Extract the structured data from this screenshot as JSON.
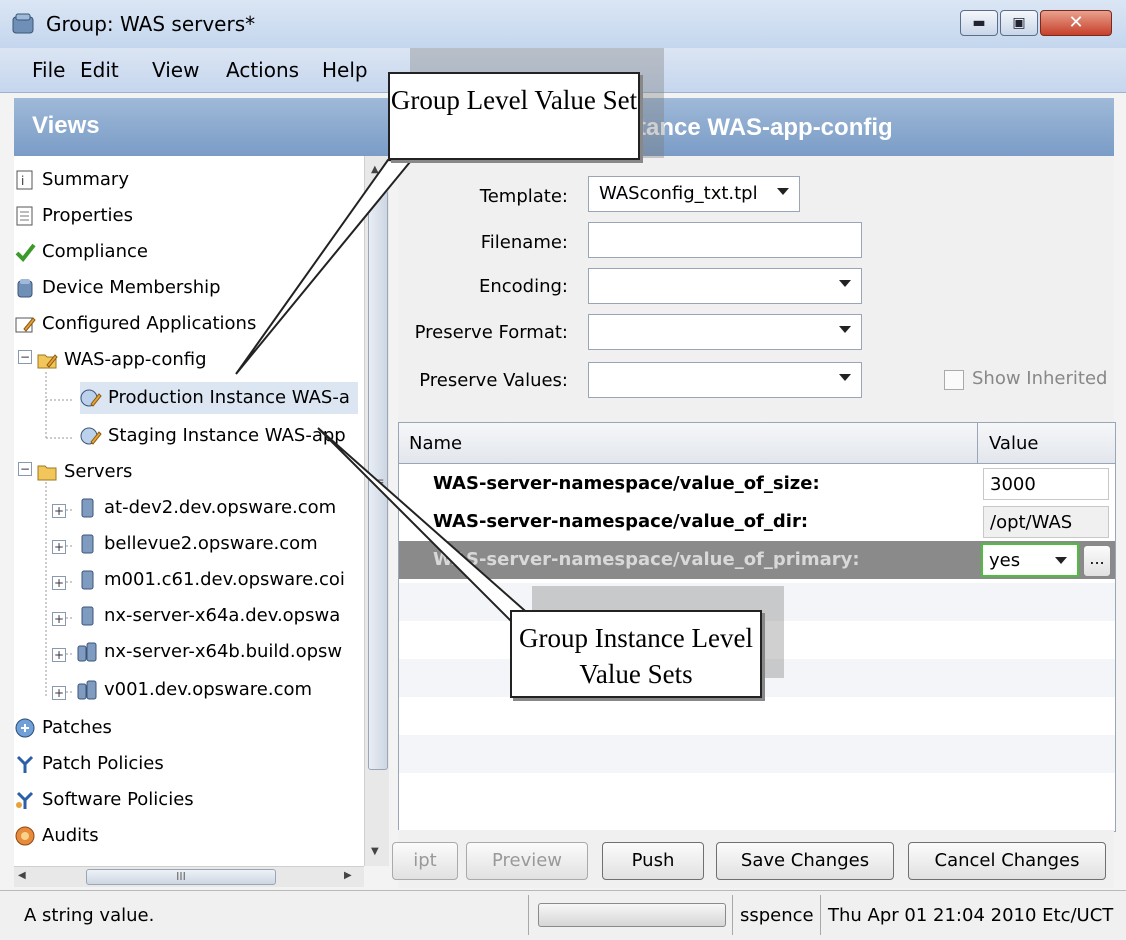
{
  "window": {
    "title": "Group: WAS servers*",
    "min_glyph": "▬",
    "max_glyph": "▣",
    "close_glyph": "✕"
  },
  "menu": [
    "File",
    "Edit",
    "View",
    "Actions",
    "Help"
  ],
  "left": {
    "title": "Views",
    "tree": [
      {
        "label": "Summary",
        "icon": "summary-icon"
      },
      {
        "label": "Properties",
        "icon": "properties-icon"
      },
      {
        "label": "Compliance",
        "icon": "compliance-icon"
      },
      {
        "label": "Device Membership",
        "icon": "device-membership-icon"
      },
      {
        "label": "Configured Applications",
        "icon": "configured-applications-icon"
      },
      {
        "label": "WAS-app-config",
        "icon": "app-config-icon"
      },
      {
        "label": "Production Instance WAS-a",
        "icon": "instance-icon"
      },
      {
        "label": "Staging Instance WAS-app",
        "icon": "instance-icon"
      },
      {
        "label": "Servers",
        "icon": "folder-icon"
      },
      {
        "label": "at-dev2.dev.opsware.com",
        "icon": "server-icon"
      },
      {
        "label": "bellevue2.opsware.com",
        "icon": "server-icon"
      },
      {
        "label": "m001.c61.dev.opsware.coi",
        "icon": "server-icon"
      },
      {
        "label": "nx-server-x64a.dev.opswa",
        "icon": "server-icon"
      },
      {
        "label": "nx-server-x64b.build.opsw",
        "icon": "server-group-icon"
      },
      {
        "label": "v001.dev.opsware.com",
        "icon": "server-group-icon"
      },
      {
        "label": "Patches",
        "icon": "patches-icon"
      },
      {
        "label": "Patch Policies",
        "icon": "patch-policies-icon"
      },
      {
        "label": "Software Policies",
        "icon": "software-policies-icon"
      },
      {
        "label": "Audits",
        "icon": "audits-icon"
      }
    ],
    "hscroll_grip": "III"
  },
  "right": {
    "title": "tance WAS-app-config",
    "form": {
      "template_label": "Template:",
      "template_value": "WASconfig_txt.tpl",
      "filename_label": "Filename:",
      "filename_value": "",
      "encoding_label": "Encoding:",
      "preserve_format_label": "Preserve Format:",
      "preserve_values_label": "Preserve Values:",
      "show_inherited_label": "Show Inherited"
    },
    "table": {
      "headers": [
        "Name",
        "Value"
      ],
      "rows": [
        {
          "name": "WAS-server-namespace/value_of_size:",
          "value": "3000"
        },
        {
          "name": "WAS-server-namespace/value_of_dir:",
          "value": "/opt/WAS"
        },
        {
          "name": "WAS-server-namespace/value_of_primary:",
          "value": "yes"
        }
      ],
      "more_glyph": "..."
    },
    "buttons": {
      "script": "ipt",
      "preview": "Preview",
      "push": "Push",
      "save": "Save Changes",
      "cancel": "Cancel Changes"
    }
  },
  "status": {
    "message": "A string value.",
    "user": "sspence",
    "datetime": "Thu Apr 01 21:04 2010 Etc/UCT"
  },
  "callouts": {
    "group_level": "Group Level Value Set",
    "group_instance": "Group Instance Level Value Sets"
  },
  "colors": {
    "header_blue": "#7a9cc6",
    "selected_row": "#8a8a8a",
    "active_value_border": "#4cbf3c"
  }
}
